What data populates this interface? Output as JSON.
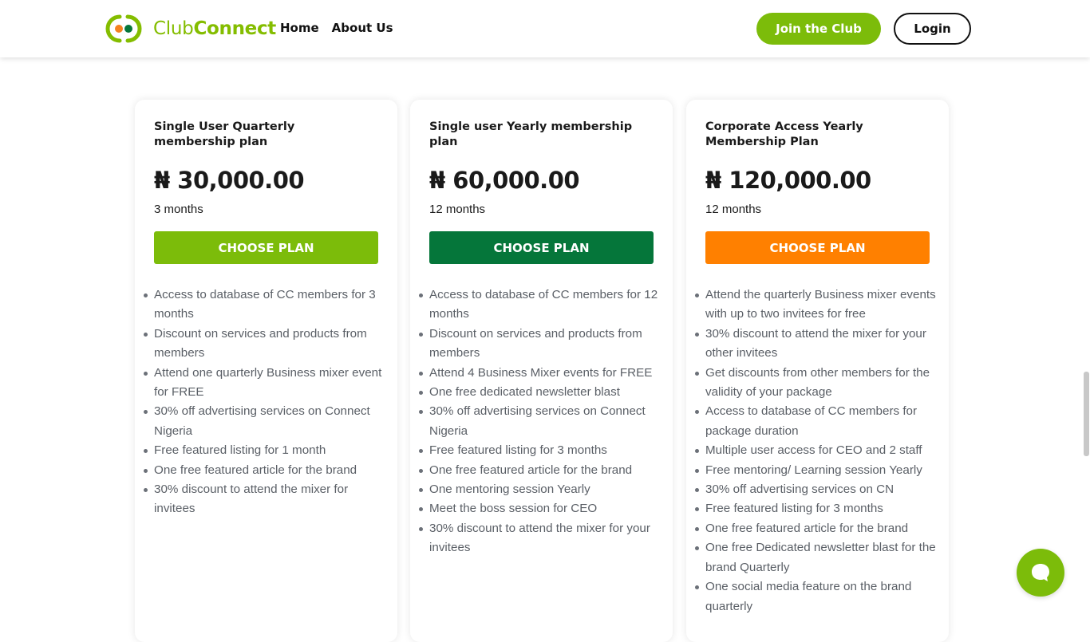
{
  "brand": {
    "name_part1": "Club",
    "name_part2": "Connect",
    "accent": "#84bd00",
    "logo_icon": "club-connect-logo"
  },
  "nav": {
    "home": "Home",
    "about": "About Us",
    "join": "Join the Club",
    "login": "Login"
  },
  "plans": [
    {
      "title": "Single User Quarterly membership plan",
      "price": "₦ 30,000.00",
      "period": "3 months",
      "button": "CHOOSE PLAN",
      "button_color": "#7cbc0a",
      "features": [
        "Access to database of CC members for 3 months",
        "Discount on services and products from members",
        "Attend one quarterly Business mixer event for FREE",
        "30% off advertising services on Connect Nigeria",
        "Free featured listing for 1 month",
        "One free featured article for the brand",
        "30% discount to attend the mixer for invitees"
      ]
    },
    {
      "title": "Single user Yearly membership plan",
      "price": "₦ 60,000.00",
      "period": "12 months",
      "button": "CHOOSE PLAN",
      "button_color": "#05763a",
      "features": [
        "Access to database of CC members for 12 months",
        "Discount on services and products from members",
        "Attend 4 Business Mixer events for FREE",
        "One free dedicated newsletter blast",
        "30% off advertising services on Connect Nigeria",
        "Free featured listing for 3 months",
        "One free featured article for the brand",
        "One mentoring session Yearly",
        "Meet the boss session for CEO",
        "30% discount to attend the mixer for your invitees"
      ]
    },
    {
      "title": "Corporate Access Yearly Membership Plan",
      "price": "₦ 120,000.00",
      "period": "12 months",
      "button": "CHOOSE PLAN",
      "button_color": "#ff8000",
      "features": [
        "Attend the quarterly Business mixer events with up to two invitees for free",
        "30% discount to attend the mixer for your other invitees",
        "Get discounts from other members for the validity of your package",
        "Access to database of CC members for package duration",
        "Multiple user access for CEO and 2 staff",
        "Free mentoring/ Learning session Yearly",
        "30% off advertising services on CN",
        "Free featured listing for 3 months",
        "One free featured article for the brand",
        "One free Dedicated newsletter blast for the brand Quarterly",
        "One social media feature on the brand quarterly"
      ]
    }
  ],
  "chat": {
    "icon": "chat-bubble-icon",
    "color": "#7cbc0a"
  }
}
